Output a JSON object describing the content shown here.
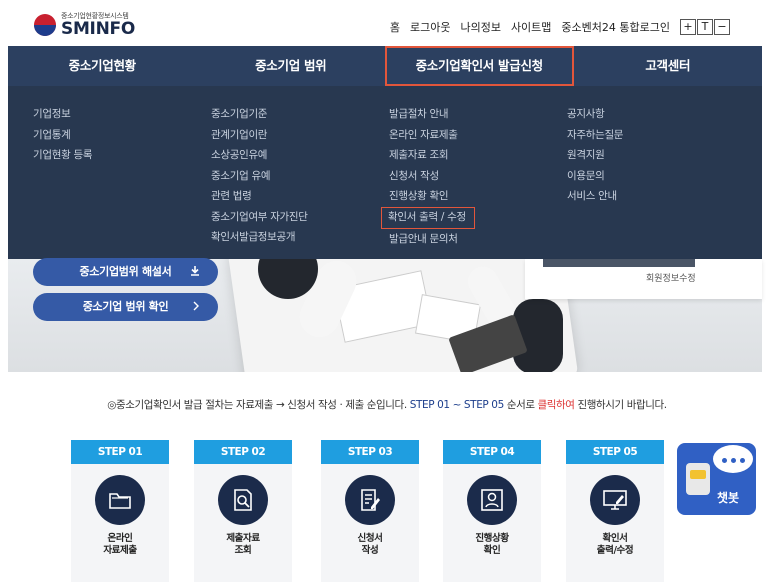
{
  "header": {
    "logo_sub": "중소기업현황정보시스템",
    "logo_main": "SMINFO",
    "util_links": [
      "홈",
      "로그아웃",
      "나의정보",
      "사이트맵",
      "중소벤처24 통합로그인"
    ],
    "font_controls": [
      "+",
      "T",
      "−"
    ]
  },
  "nav": {
    "items": [
      "중소기업현황",
      "중소기업 범위",
      "중소기업확인서 발급신청",
      "고객센터"
    ],
    "active_index": 2
  },
  "dropdown": {
    "col1": [
      "기업정보",
      "기업통계",
      "기업현황 등록"
    ],
    "col2": [
      "중소기업기준",
      "관계기업이란",
      "소상공인유예",
      "중소기업 유예",
      "관련 법령",
      "중소기업여부 자가진단",
      "확인서발급정보공개"
    ],
    "col3": [
      "발급절차 안내",
      "온라인 자료제출",
      "제출자료 조회",
      "신청서 작성",
      "진행상황 확인",
      "확인서 출력 / 수정",
      "발급안내 문의처"
    ],
    "col4": [
      "공지사항",
      "자주하는질문",
      "원격지원",
      "이용문의",
      "서비스 안내"
    ]
  },
  "hero": {
    "cta1": "중소기업범위 해설서",
    "cta2": "중소기업 범위 확인",
    "member_edit": "회원정보수정"
  },
  "notice": {
    "part1": "◎중소기업확인서 발급 절차는 자료제출 → 신청서 작성 · 제출 순입니다. ",
    "part2": "STEP 01 ~ STEP 05",
    "part3": " 순서로 ",
    "part4": "클릭하여",
    "part5": " 진행하시기 바랍니다."
  },
  "steps": [
    {
      "head": "STEP 01",
      "line1": "온라인",
      "line2": "자료제출",
      "icon": "folder-icon"
    },
    {
      "head": "STEP 02",
      "line1": "제출자료",
      "line2": "조회",
      "icon": "document-search-icon"
    },
    {
      "head": "STEP 03",
      "line1": "신청서",
      "line2": "작성",
      "icon": "form-write-icon"
    },
    {
      "head": "STEP 04",
      "line1": "진행상황",
      "line2": "확인",
      "icon": "user-status-icon"
    },
    {
      "head": "STEP 05",
      "line1": "확인서",
      "line2": "출력/수정",
      "icon": "monitor-print-icon"
    }
  ],
  "chatbot": {
    "label": "챗봇"
  },
  "colors": {
    "nav_bg": "#2c4060",
    "dropdown_bg": "#283850",
    "highlight": "#e2563b",
    "step_head": "#1f9ee0",
    "cta": "#355aa6"
  }
}
